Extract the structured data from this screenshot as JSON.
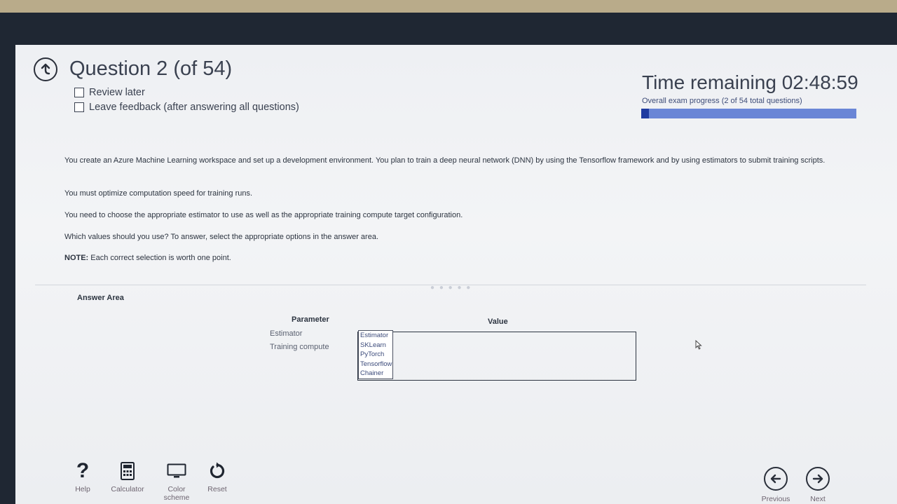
{
  "header": {
    "question_title": "Question 2 (of 54)",
    "review_later": "Review later",
    "leave_feedback": "Leave feedback (after answering all questions)",
    "time_remaining": "Time remaining 02:48:59",
    "progress_label": "Overall exam progress (2 of 54 total questions)",
    "progress_fraction": 0.037
  },
  "question": {
    "paragraph1": "You create an Azure Machine Learning workspace and set up a development environment. You plan to train a deep neural network (DNN) by using the Tensorflow framework and by using estimators to submit training scripts.",
    "paragraph2": "You must optimize computation speed for training runs.",
    "paragraph3": "You need to choose the appropriate estimator to use as well as the appropriate training compute target configuration.",
    "paragraph4": "Which values should you use? To answer, select the appropriate options in the answer area.",
    "note_label": "NOTE:",
    "note_text": " Each correct selection is worth one point."
  },
  "answer_area": {
    "title": "Answer Area",
    "parameter_header": "Parameter",
    "value_header": "Value",
    "rows": [
      "Estimator",
      "Training compute"
    ],
    "dropdown_options": [
      "Estimator",
      "SKLearn",
      "PyTorch",
      "Tensorflow",
      "Chainer"
    ]
  },
  "toolbar": {
    "help": "Help",
    "calculator": "Calculator",
    "color_scheme": "Color scheme",
    "reset": "Reset"
  },
  "navigation": {
    "previous": "Previous",
    "next": "Next"
  },
  "colors": {
    "progress_bar": "#6a86d6",
    "progress_fill": "#1f3ba0",
    "background": "#eef0f3",
    "bezel": "#1f2733"
  }
}
